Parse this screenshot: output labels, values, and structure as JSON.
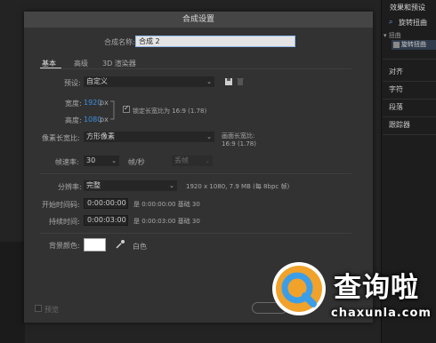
{
  "dialog": {
    "title": "合成设置",
    "name_label": "合成名称:",
    "name_value": "合成 2",
    "tabs": [
      "基本",
      "高级",
      "3D 渲染器"
    ],
    "preset": {
      "label": "预设:",
      "value": "自定义"
    },
    "width": {
      "label": "宽度:",
      "value": "1920",
      "unit": "px"
    },
    "height": {
      "label": "高度:",
      "value": "1080",
      "unit": "px"
    },
    "lock_aspect": "锁定长宽比为 16:9 (1.78)",
    "pixel_aspect": {
      "label": "像素长宽比:",
      "value": "方形像素"
    },
    "frame_aspect": {
      "label": "画面长宽比:",
      "value": "16:9 (1.78)"
    },
    "frame_rate": {
      "label": "帧速率:",
      "value": "30",
      "unit": "帧/秒",
      "dropframe": "丢帧"
    },
    "resolution": {
      "label": "分辨率:",
      "value": "完整",
      "info": "1920 x 1080, 7.9 MB (每 8bpc 帧)"
    },
    "start_timecode": {
      "label": "开始时间码:",
      "value": "0:00:00:00",
      "info": "是 0:00:00:00 基础 30"
    },
    "duration": {
      "label": "持续时间:",
      "value": "0:00:03:00",
      "info": "是 0:00:03:00 基础 30"
    },
    "bg_color": {
      "label": "背景颜色:",
      "color": "#ffffff",
      "name": "白色"
    },
    "preview_label": "预览"
  },
  "right_panel": {
    "title": "效果和预设",
    "search_text": "旋转扭曲",
    "group": "扭曲",
    "item": "旋转扭曲",
    "sections": [
      "对齐",
      "字符",
      "段落",
      "跟踪器"
    ]
  },
  "watermark": {
    "text": "查询啦",
    "url": "chaxunla.com"
  }
}
